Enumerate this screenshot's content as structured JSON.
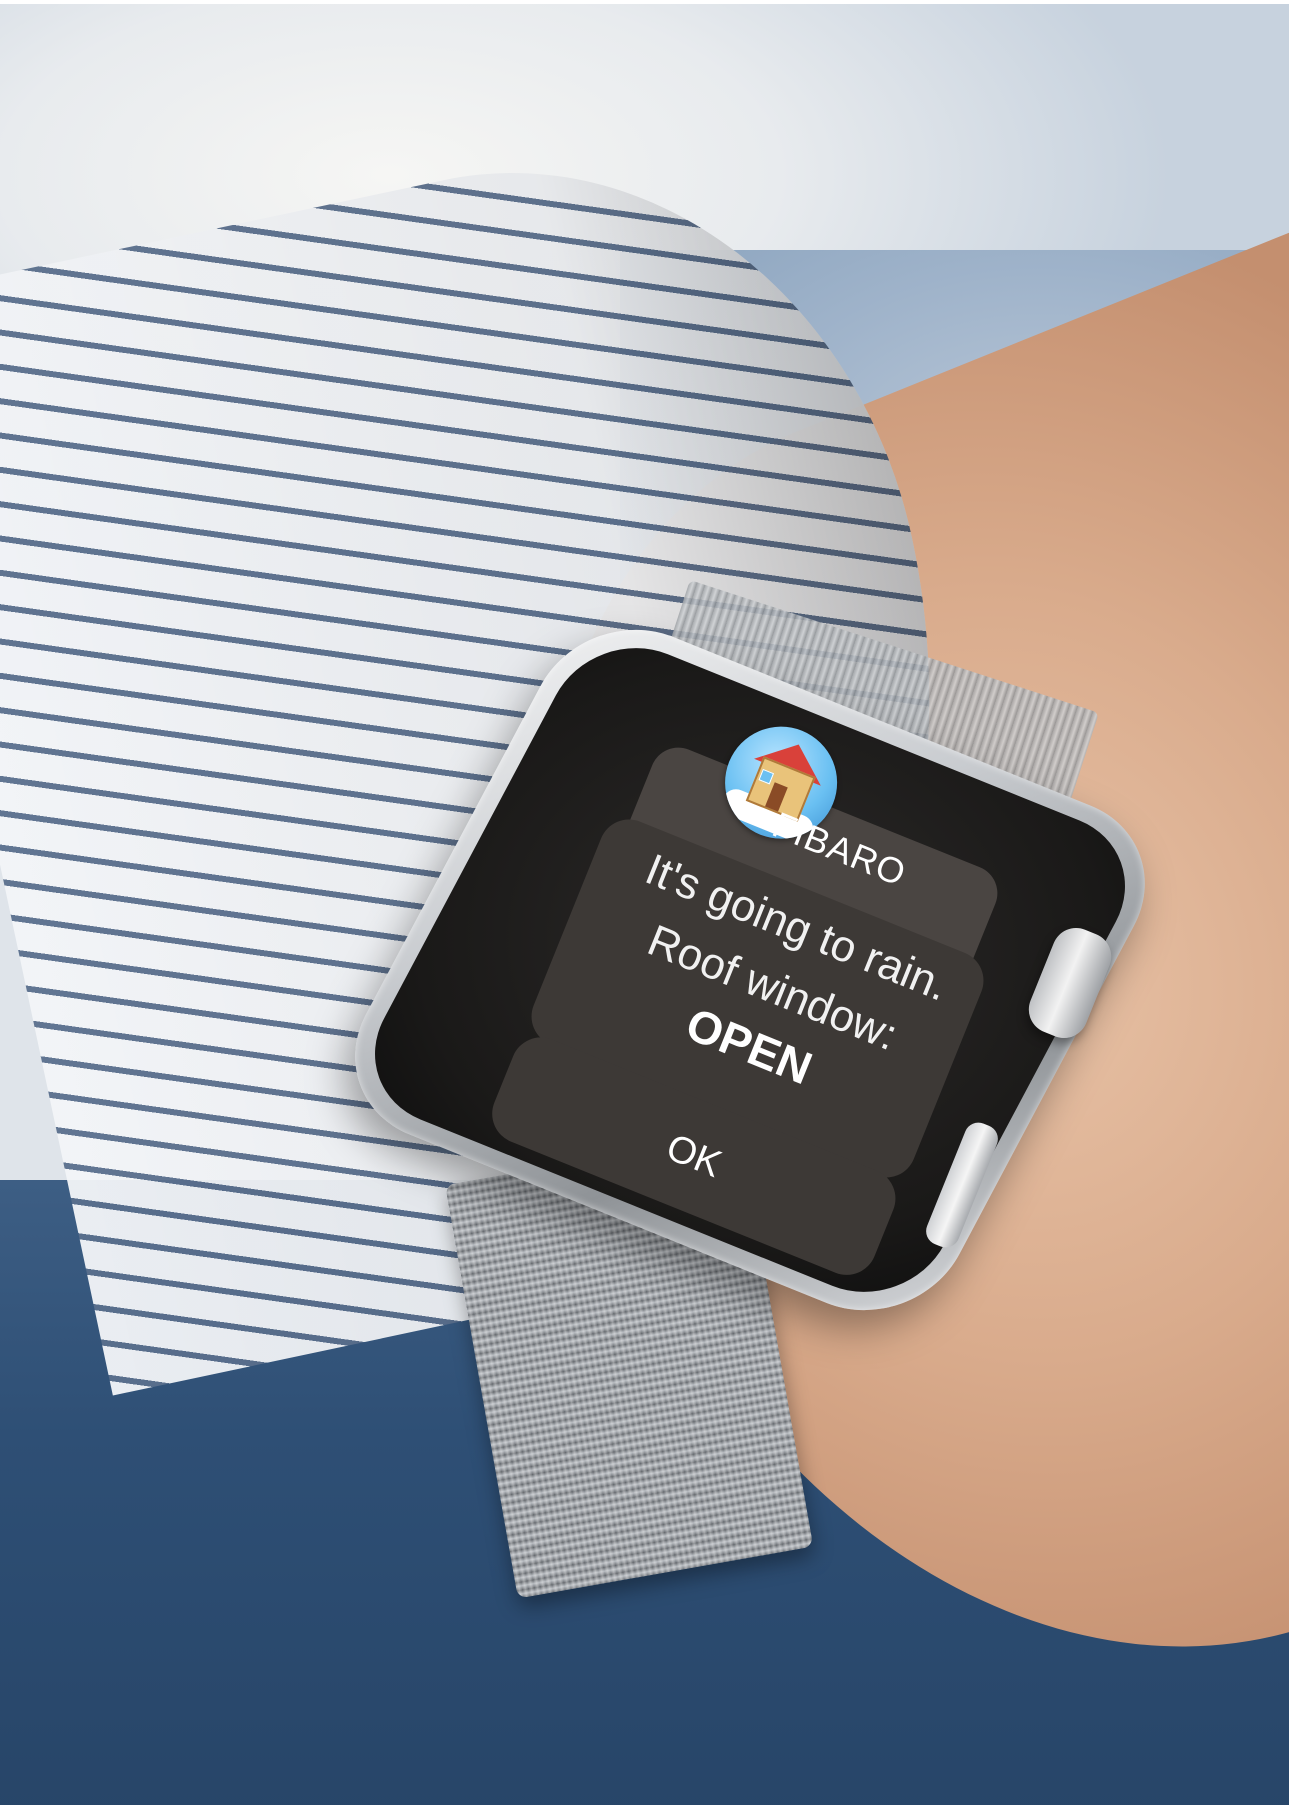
{
  "notification": {
    "app_name": "FIBARO",
    "app_icon": "house-in-clouds-icon",
    "message_line1": "It's going to rain.",
    "message_line2": "Roof window:",
    "message_line3": "OPEN",
    "action_label": "OK"
  },
  "colors": {
    "screen_background": "#1a1918",
    "card_background": "#3d3936",
    "text": "#ffffff"
  }
}
